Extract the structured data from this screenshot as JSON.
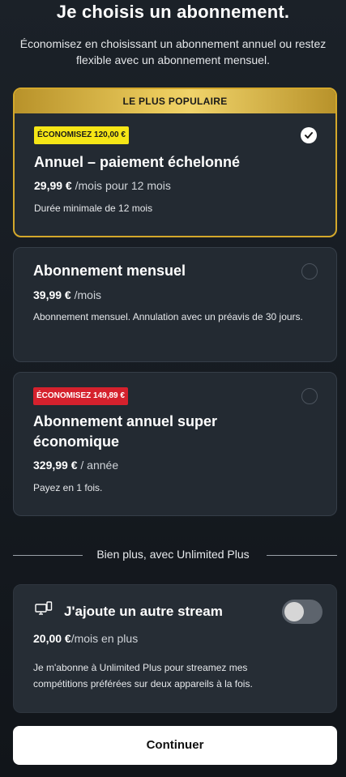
{
  "header": {
    "title": "Je choisis un abonnement.",
    "subtitle": "Économisez en choisissant un abonnement annuel ou restez flexible avec un abonnement mensuel."
  },
  "plans": [
    {
      "ribbon": "LE PLUS POPULAIRE",
      "badge": "ÉCONOMISEZ 120,00 €",
      "name": "Annuel – paiement échelonné",
      "price": "29,99 €",
      "period": "/mois pour 12 mois",
      "description": "Durée minimale de 12 mois",
      "selected": true
    },
    {
      "name": "Abonnement mensuel",
      "price": "39,99 €",
      "period": "/mois",
      "description": "Abonnement mensuel. Annulation avec un préavis de 30 jours.",
      "selected": false
    },
    {
      "badge": "ÉCONOMISEZ 149,89 €",
      "name": "Abonnement annuel super économique",
      "price": "329,99 €",
      "period": "/ année",
      "description": "Payez en 1 fois.",
      "selected": false
    }
  ],
  "addon_divider": "Bien plus, avec Unlimited Plus",
  "addon": {
    "icon": "multi-screen-icon",
    "title": "J'ajoute un autre stream",
    "price": "20,00 €",
    "period": "/mois en plus",
    "description": "Je m'abonne à Unlimited Plus pour streamez mes compétitions préférées sur deux appareils à la fois.",
    "enabled": false
  },
  "continue_label": "Continuer",
  "colors": {
    "gold": "#d4a82b",
    "yellow_badge": "#f5e616",
    "red_badge": "#d5212d",
    "card_bg": "#232a32"
  }
}
